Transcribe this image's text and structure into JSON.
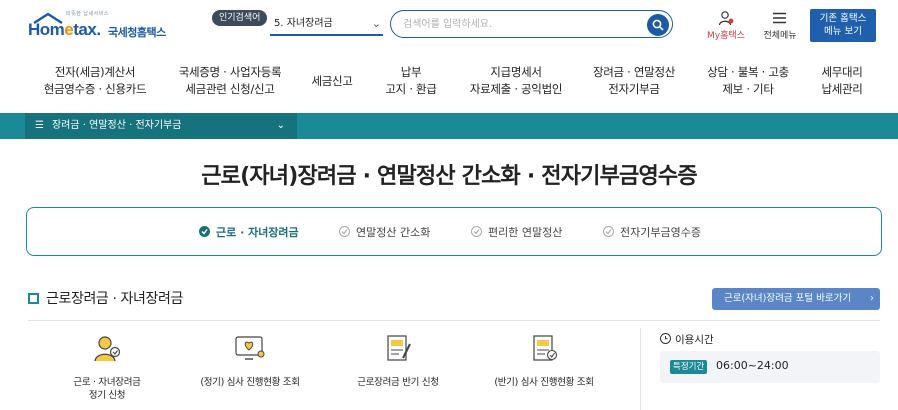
{
  "header": {
    "logo_tagline": "따뜻한 납세서비스",
    "logo_brand_pre": "Hom",
    "logo_brand_e": "e",
    "logo_brand_post": "tax.",
    "logo_korean": "국세청홈택스",
    "popular_badge": "인기검색어",
    "popular_keyword": "5.  자녀장려금",
    "search_placeholder": "검색어를 입력하세요.",
    "my_hometax": "My홈택스",
    "all_menu": "전체메뉴",
    "old_hometax_line1": "기존 홈택스",
    "old_hometax_line2": "메뉴 보기"
  },
  "gnb": [
    {
      "line1": "전자(세금)계산서",
      "line2": "현금영수증 · 신용카드"
    },
    {
      "line1": "국세증명 · 사업자등록",
      "line2": "세금관련 신청/신고"
    },
    {
      "line1": "세금신고",
      "line2": ""
    },
    {
      "line1": "납부",
      "line2": "고지 · 환급"
    },
    {
      "line1": "지급명세서",
      "line2": "자료제출 · 공익법인"
    },
    {
      "line1": "장려금 · 연말정산",
      "line2": "전자기부금"
    },
    {
      "line1": "상담 · 불복 · 고충",
      "line2": "제보 · 기타"
    },
    {
      "line1": "세무대리",
      "line2": "납세관리"
    }
  ],
  "breadcrumb": {
    "label": "장려금 · 연말정산 · 전자기부금"
  },
  "page_title": "근로(자녀)장려금 · 연말정산 간소화 · 전자기부금영수증",
  "tabs": [
    {
      "label": "근로 · 자녀장려금",
      "active": true
    },
    {
      "label": "연말정산 간소화",
      "active": false
    },
    {
      "label": "편리한 연말정산",
      "active": false
    },
    {
      "label": "전자기부금영수증",
      "active": false
    }
  ],
  "section": {
    "title": "근로장려금 · 자녀장려금",
    "portal_button": "근로(자녀)장려금 포털 바로가기"
  },
  "services": [
    {
      "label": "근로 · 자녀장려금\n정기 신청",
      "icon": "person-coin-icon"
    },
    {
      "label": "(정기) 심사 진행현황 조회",
      "icon": "monitor-heart-icon"
    },
    {
      "label": "근로장려금 반기 신청",
      "icon": "document-pen-icon"
    },
    {
      "label": "(반기) 심사 진행현황 조회",
      "icon": "document-check-icon"
    }
  ],
  "hours": {
    "title": "이용시간",
    "tag": "특정기간",
    "time": "06:00~24:00"
  },
  "colors": {
    "teal": "#1b8a96",
    "brand_blue": "#1c5aa6",
    "accent_orange": "#f29100"
  }
}
